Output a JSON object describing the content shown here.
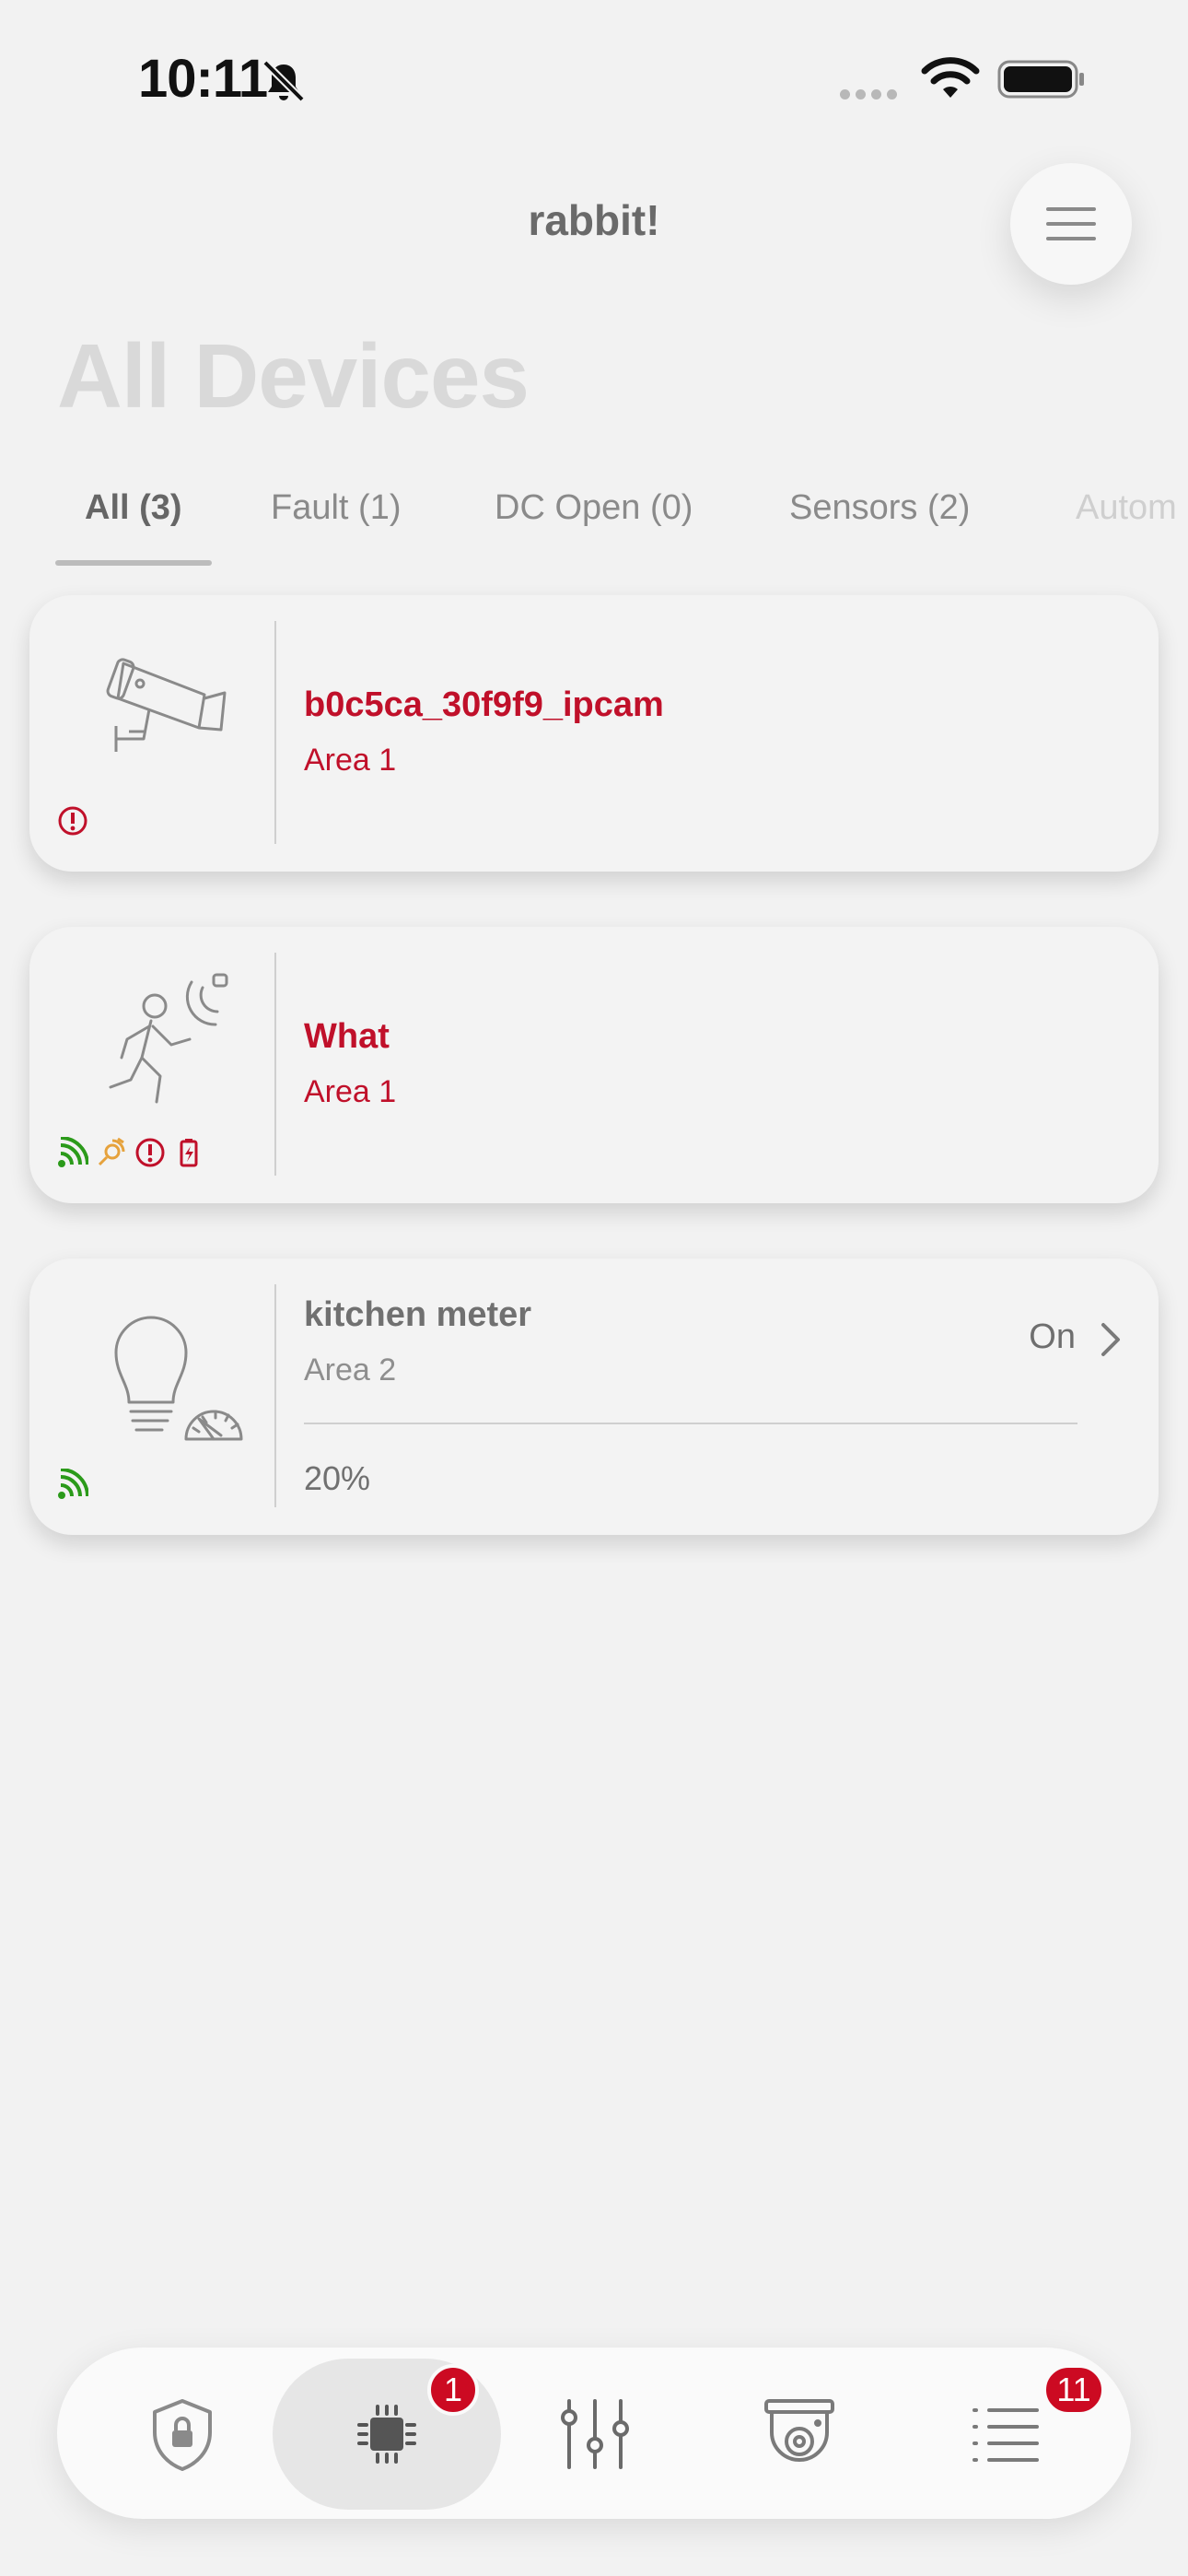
{
  "status_bar": {
    "time": "10:11"
  },
  "header": {
    "app_title": "rabbit!",
    "page_title": "All Devices"
  },
  "tabs": [
    {
      "label": "All (3)",
      "active": true
    },
    {
      "label": "Fault (1)"
    },
    {
      "label": "DC Open (0)"
    },
    {
      "label": "Sensors (2)"
    },
    {
      "label": "Autom"
    }
  ],
  "devices": [
    {
      "name": "b0c5ca_30f9f9_ipcam",
      "area": "Area 1",
      "icon": "ip-camera-icon",
      "status_icons": [
        "fault-icon"
      ]
    },
    {
      "name": "What",
      "area": "Area 1",
      "icon": "motion-sensor-icon",
      "status_icons": [
        "signal-icon",
        "bypass-icon",
        "fault-icon",
        "battery-icon"
      ]
    },
    {
      "name": "kitchen meter",
      "area": "Area 2",
      "icon": "dimmer-light-icon",
      "state": "On",
      "level": "20%",
      "status_icons": [
        "signal-icon"
      ]
    }
  ],
  "bottom_nav": {
    "items": [
      {
        "icon": "security-shield-icon"
      },
      {
        "icon": "devices-chip-icon",
        "badge": "1",
        "active": true
      },
      {
        "icon": "controls-sliders-icon"
      },
      {
        "icon": "camera-icon"
      },
      {
        "icon": "list-icon",
        "badge": "11"
      }
    ]
  },
  "colors": {
    "fault_red": "#c0102a",
    "signal_green": "#2b9a1a",
    "bypass_orange": "#e6a23c",
    "badge_red": "#cc0a22"
  }
}
